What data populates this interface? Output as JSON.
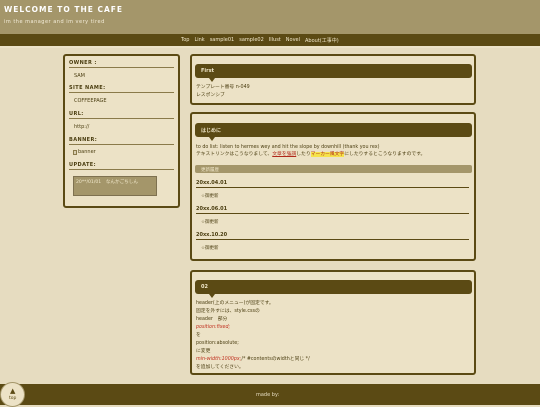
{
  "header": {
    "title": "WELCOME TO THE CAFE",
    "description": "im the manager and im very tired"
  },
  "nav": {
    "items": [
      "Top",
      "Link",
      "sample01",
      "sample02",
      "Illust",
      "Novel",
      "About(工事中)"
    ]
  },
  "sidebar": {
    "owner_label": "OWNER :",
    "owner_value": "SAM",
    "site_name_label": "SITE NAME:",
    "site_name_value": "COFFEEPAGE",
    "url_label": "URL:",
    "url_value": "http://",
    "banner_label": "BANNER:",
    "banner_alt": "banner",
    "update_label": "UPDATE:",
    "update_text": "20**/01/01　なんかごちしん"
  },
  "panels": {
    "first": {
      "title": "First",
      "line1": "テンプレート番号 n-049",
      "line2": "レスポンシブ"
    },
    "intro": {
      "title": "はじめに",
      "line1": "to do list: listen to hermes wey and hit the slope by downhill (thank you rex)",
      "line2_a": "テキストリンクはこうなりまして、",
      "line2_link": "文章を強調",
      "line2_b": "したり",
      "line2_marker": "マーカー風文字",
      "line2_c": "にしたりするとこうなりますのです。",
      "history_label": "更新履歴",
      "entries": [
        {
          "date": "20xx.04.01",
          "note": "☆御更新"
        },
        {
          "date": "20xx.06.01",
          "note": "☆御更新"
        },
        {
          "date": "20xx.10.20",
          "note": "☆御更新"
        }
      ]
    },
    "second": {
      "title": "02",
      "line1": "header(上のメニュー)が固定です。",
      "line2": "固定を外すには、style.cssの",
      "line3": "header　部分",
      "line4": "position:fixed;",
      "line5": "を",
      "line6": "position:absolute;",
      "line7": "に変更",
      "line8_red": "min-width:1000px;",
      "line8_rest": "/* #contentsのwidthと同じ */",
      "line9": "を追加してください。"
    }
  },
  "footer": {
    "text": "made by:",
    "top_arrow": "▲",
    "top_label": "top"
  }
}
